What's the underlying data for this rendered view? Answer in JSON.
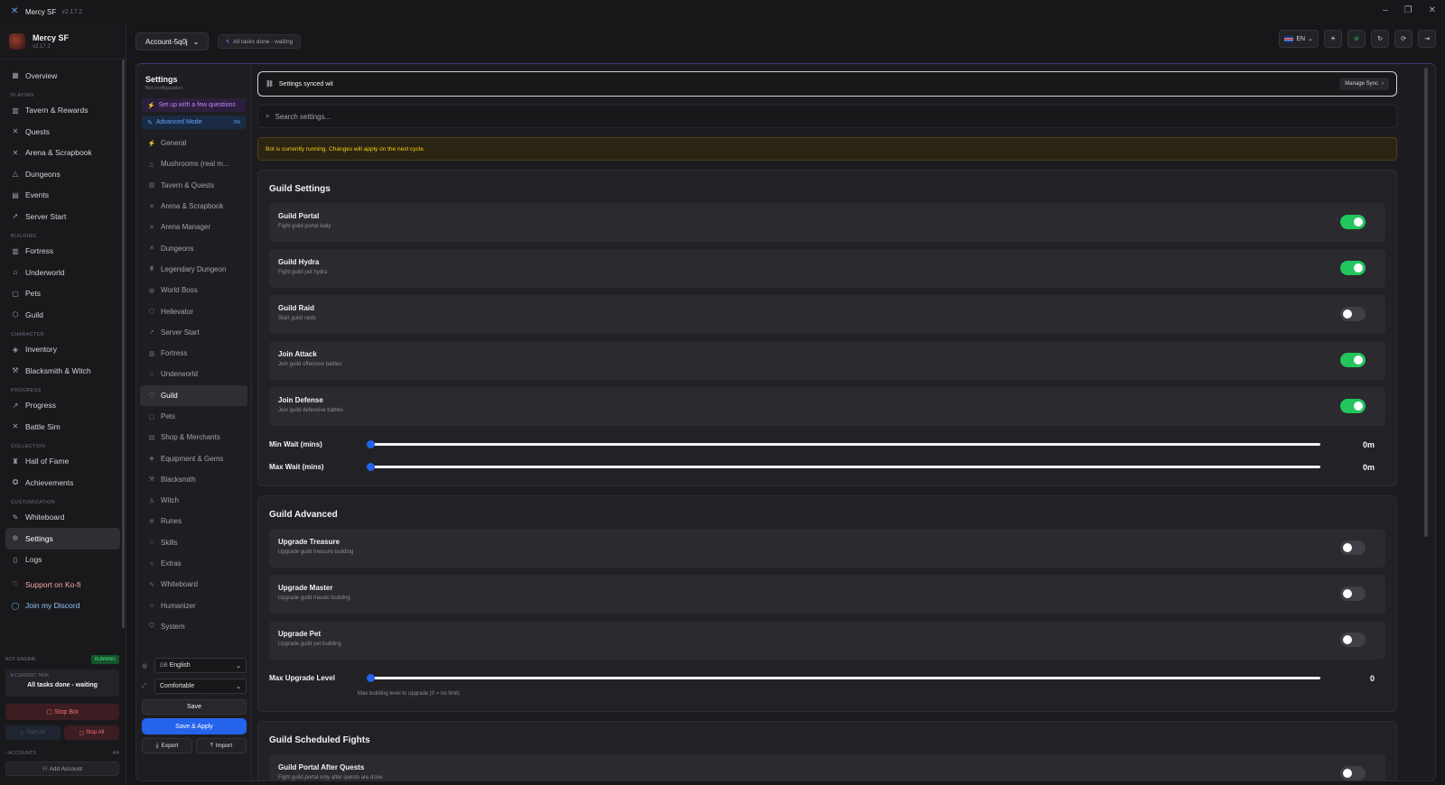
{
  "app": {
    "name": "Mercy SF",
    "version": "v2.17.2"
  },
  "sidebar": {
    "profile_name": "Mercy SF",
    "profile_version": "v2.17.2",
    "overview": "Overview",
    "sections": {
      "playing": "PLAYING",
      "building": "BUILDING",
      "character": "CHARACTER",
      "progress": "PROGRESS",
      "collection": "COLLECTION",
      "customization": "CUSTOMIZATION"
    },
    "items": {
      "tavern": "Tavern & Rewards",
      "quests": "Quests",
      "arena": "Arena & Scrapbook",
      "dungeons": "Dungeons",
      "events": "Events",
      "server_start": "Server Start",
      "fortress": "Fortress",
      "underworld": "Underworld",
      "pets": "Pets",
      "guild": "Guild",
      "inventory": "Inventory",
      "blacksmith": "Blacksmith & Witch",
      "progress": "Progress",
      "battle_sim": "Battle Sim",
      "hall_of_fame": "Hall of Fame",
      "achievements": "Achievements",
      "whiteboard": "Whiteboard",
      "settings": "Settings",
      "logs": "Logs",
      "kofi": "Support on Ko-fi",
      "discord": "Join my Discord"
    },
    "engine": {
      "label": "BOT ENGINE",
      "status": "RUNNING",
      "current_task_label": "CURRENT TASK",
      "current_task": "All tasks done - waiting",
      "stop_bot": "Stop Bot",
      "start_all": "Start All",
      "stop_all": "Stop All",
      "accounts_label": "ACCOUNTS",
      "accounts_count": "4/4",
      "add_account": "Add Account"
    }
  },
  "topbar": {
    "account": "Account-5q0j",
    "status": "All tasks done - waiting",
    "lang": "EN"
  },
  "settings_nav": {
    "title": "Settings",
    "subtitle": "Bot configuration",
    "wizard": "Set up with a few questions",
    "advanced_mode": "Advanced Mode",
    "advanced_state": "ON",
    "items": [
      "General",
      "Mushrooms (real m...",
      "Tavern & Quests",
      "Arena & Scrapbook",
      "Arena Manager",
      "Dungeons",
      "Legendary Dungeon",
      "World Boss",
      "Hellevator",
      "Server Start",
      "Fortress",
      "Underworld",
      "Guild",
      "Pets",
      "Shop & Merchants",
      "Equipment & Gems",
      "Blacksmith",
      "Witch",
      "Runes",
      "Skills",
      "Extras",
      "Whiteboard",
      "Humanizer",
      "System"
    ],
    "active_index": 12,
    "language_select": "English",
    "density_select": "Comfortable",
    "save": "Save",
    "save_apply": "Save & Apply",
    "export": "Export",
    "import": "Import"
  },
  "content": {
    "synced_text": "Settings synced wit",
    "manage_sync": "Manage Sync",
    "search_placeholder": "Search settings...",
    "warning": "Bot is currently running. Changes will apply on the next cycle.",
    "guild_settings": {
      "title": "Guild Settings",
      "toggles": [
        {
          "label": "Guild Portal",
          "desc": "Fight guild portal daily",
          "on": true
        },
        {
          "label": "Guild Hydra",
          "desc": "Fight guild pet hydra",
          "on": true
        },
        {
          "label": "Guild Raid",
          "desc": "Start guild raids",
          "on": false
        },
        {
          "label": "Join Attack",
          "desc": "Join guild offensive battles",
          "on": true
        },
        {
          "label": "Join Defense",
          "desc": "Join guild defensive battles",
          "on": true
        }
      ],
      "min_wait_label": "Min Wait (mins)",
      "min_wait_value": "0m",
      "max_wait_label": "Max Wait (mins)",
      "max_wait_value": "0m"
    },
    "guild_advanced": {
      "title": "Guild Advanced",
      "toggles": [
        {
          "label": "Upgrade Treasure",
          "desc": "Upgrade guild treasure building",
          "on": false
        },
        {
          "label": "Upgrade Master",
          "desc": "Upgrade guild master building",
          "on": false
        },
        {
          "label": "Upgrade Pet",
          "desc": "Upgrade guild pet building",
          "on": false
        }
      ],
      "max_level_label": "Max Upgrade Level",
      "max_level_value": "0",
      "max_level_hint": "Max building level to upgrade (0 = no limit)"
    },
    "guild_scheduled": {
      "title": "Guild Scheduled Fights",
      "toggles": [
        {
          "label": "Guild Portal After Quests",
          "desc": "Fight guild portal only after quests are done",
          "on": false
        }
      ]
    }
  }
}
